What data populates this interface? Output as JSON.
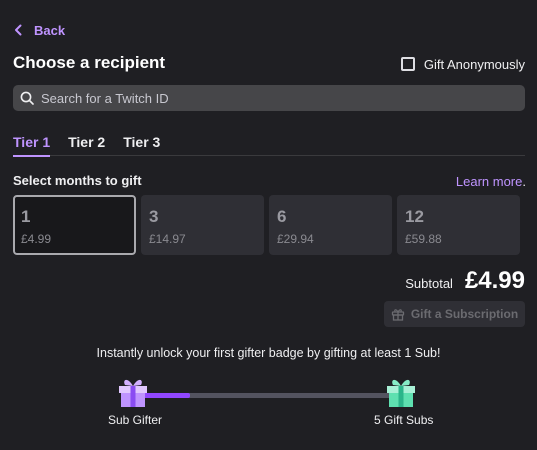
{
  "header": {
    "back_label": "Back",
    "title": "Choose a recipient",
    "anonymous_label": "Gift Anonymously",
    "anonymous_checked": false
  },
  "search": {
    "placeholder": "Search for a Twitch ID",
    "value": ""
  },
  "tabs": [
    {
      "label": "Tier 1",
      "active": true
    },
    {
      "label": "Tier 2",
      "active": false
    },
    {
      "label": "Tier 3",
      "active": false
    }
  ],
  "months": {
    "label": "Select months to gift",
    "learn_more": "Learn more",
    "learn_more_suffix": ".",
    "options": [
      {
        "qty": "1",
        "price": "£4.99",
        "selected": true
      },
      {
        "qty": "3",
        "price": "£14.97",
        "selected": false
      },
      {
        "qty": "6",
        "price": "£29.94",
        "selected": false
      },
      {
        "qty": "12",
        "price": "£59.88",
        "selected": false
      }
    ]
  },
  "summary": {
    "subtotal_label": "Subtotal",
    "subtotal_value": "£4.99",
    "gift_button_label": "Gift a Subscription"
  },
  "badge": {
    "promo_text": "Instantly unlock your first gifter badge by gifting at least 1 Sub!",
    "progress": 0.22,
    "start_label": "Sub Gifter",
    "end_label": "5 Gift Subs",
    "start_color": "#bf94ff",
    "end_color": "#5ee0b0",
    "accent": "#9147ff"
  }
}
